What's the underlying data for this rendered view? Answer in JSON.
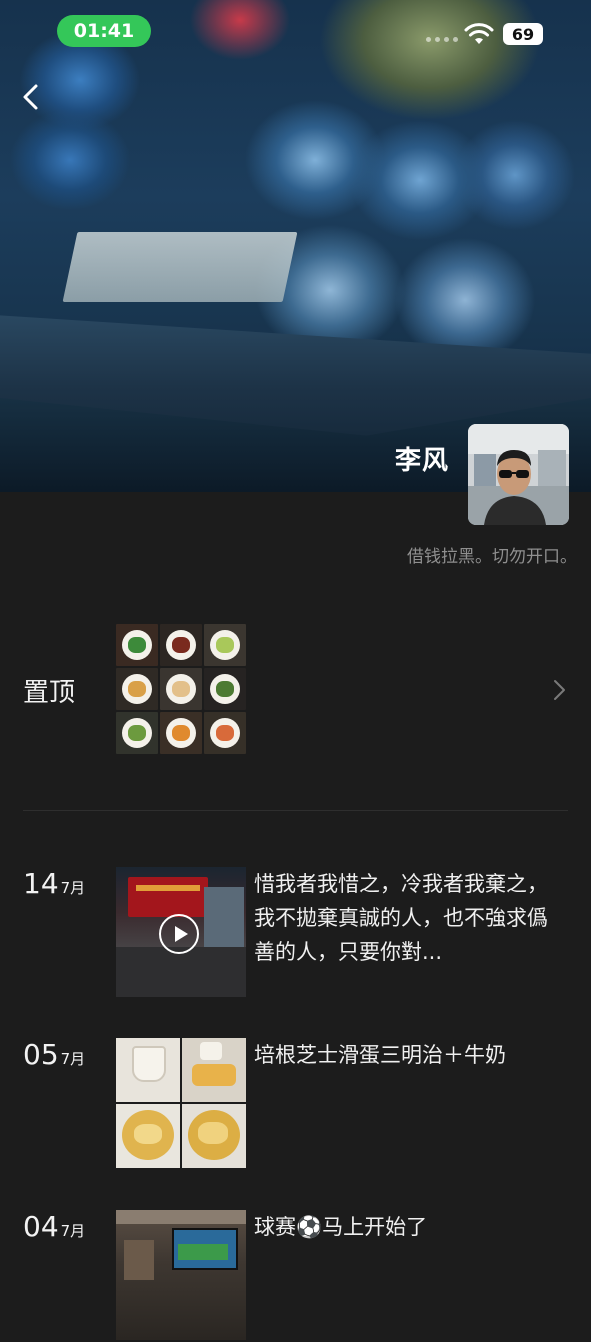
{
  "status_bar": {
    "time": "01:41",
    "battery": "69"
  },
  "profile": {
    "name": "李风",
    "signature": "借钱拉黑。切勿开口。"
  },
  "pinned": {
    "label": "置顶"
  },
  "posts": [
    {
      "day": "14",
      "month": "7月",
      "text": "惜我者我惜之，冷我者我棄之，我不拋棄真誠的人，也不強求僞善的人，只要你對...",
      "media": "video"
    },
    {
      "day": "05",
      "month": "7月",
      "text": "培根芝士滑蛋三明治＋牛奶",
      "media": "photos"
    },
    {
      "day": "04",
      "month": "7月",
      "text": "球赛⚽马上开始了",
      "media": "photo"
    }
  ]
}
